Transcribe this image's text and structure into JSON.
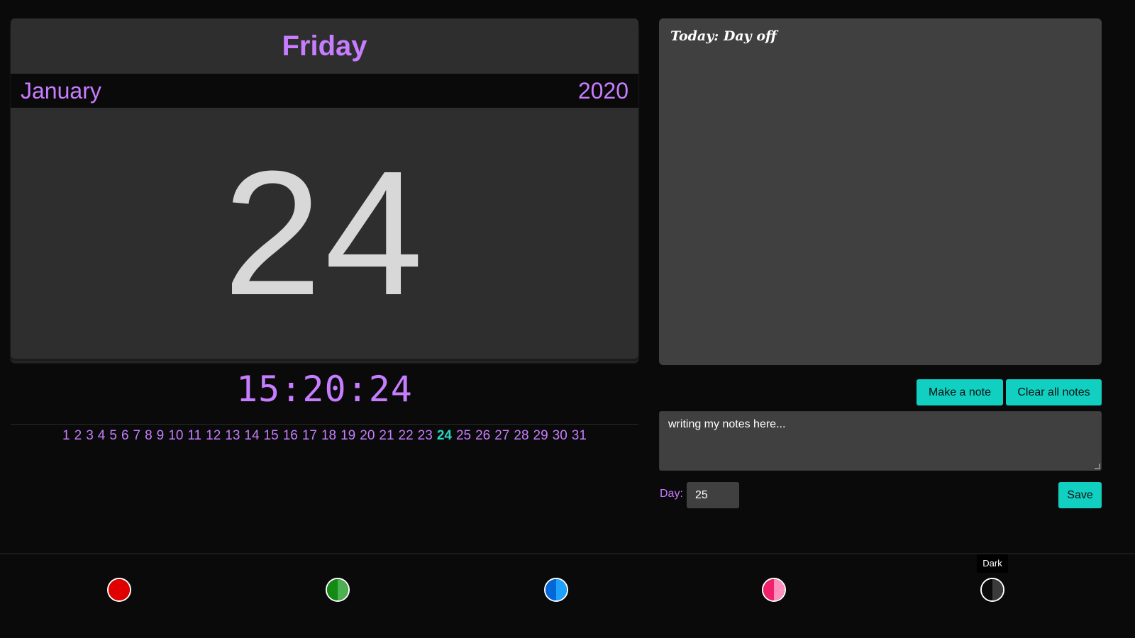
{
  "calendar": {
    "weekday": "Friday",
    "month": "January",
    "year": "2020",
    "day": "24",
    "time": "15:20:24",
    "days": [
      "1",
      "2",
      "3",
      "4",
      "5",
      "6",
      "7",
      "8",
      "9",
      "10",
      "11",
      "12",
      "13",
      "14",
      "15",
      "16",
      "17",
      "18",
      "19",
      "20",
      "21",
      "22",
      "23",
      "24",
      "25",
      "26",
      "27",
      "28",
      "29",
      "30",
      "31"
    ],
    "current_day": "24"
  },
  "notes": {
    "today_text": "Today: Day off",
    "make_note_label": "Make a note",
    "clear_all_label": "Clear all notes",
    "input_value": "writing my notes here...",
    "day_label": "Day:",
    "day_value": "25",
    "save_label": "Save"
  },
  "themes": {
    "tooltip": "Dark",
    "swatches": [
      {
        "name": "red",
        "left_color": "#e00000",
        "right_color": "#e00000"
      },
      {
        "name": "green",
        "left_color": "#138a13",
        "right_color": "#4caf50"
      },
      {
        "name": "blue",
        "left_color": "#0068d8",
        "right_color": "#1ea0ff"
      },
      {
        "name": "pink",
        "left_color": "#f0206a",
        "right_color": "#ff8fbd"
      },
      {
        "name": "dark",
        "left_color": "#0a0a0a",
        "right_color": "#3a3a3a"
      }
    ]
  },
  "colors": {
    "accent": "#c77dff",
    "button": "#11cfc1",
    "highlight": "#2ad4c4"
  }
}
